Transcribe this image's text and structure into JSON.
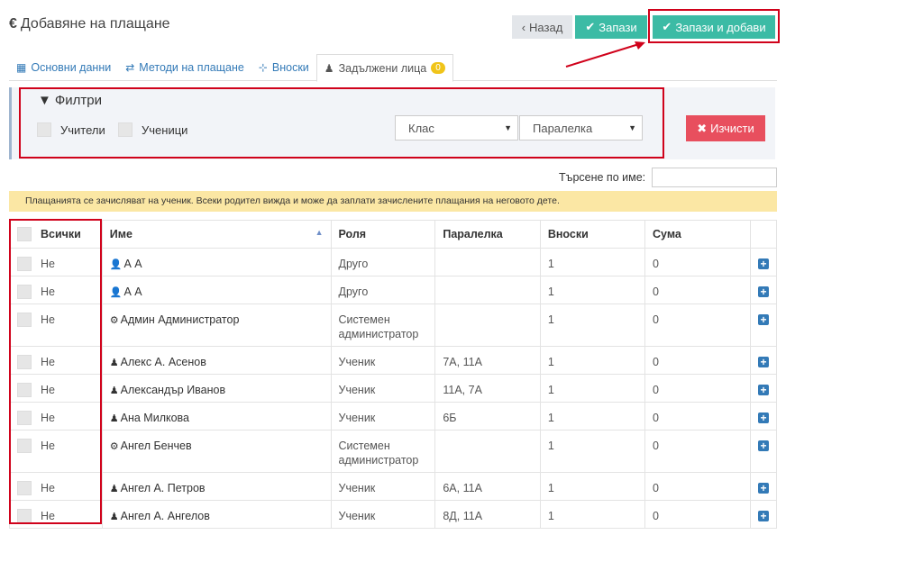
{
  "header": {
    "title_icon": "€",
    "title": "Добавяне на плащане",
    "back_label": "Назад",
    "save_label": "Запази",
    "save_add_label": "Запази и добави"
  },
  "tabs": [
    {
      "label": "Основни данни",
      "icon": "grid-icon"
    },
    {
      "label": "Методи на плащане",
      "icon": "exchange-icon"
    },
    {
      "label": "Вноски",
      "icon": "sitemap-icon"
    },
    {
      "label": "Задължени лица",
      "icon": "student-icon",
      "badge": "0"
    }
  ],
  "filters": {
    "title": "Филтри",
    "teachers_label": "Учители",
    "students_label": "Ученици",
    "class_select": "Клас",
    "paralelka_select": "Паралелка",
    "clear_label": "Изчисти"
  },
  "search": {
    "label": "Търсене по име:",
    "value": ""
  },
  "notice": "Плащанията се зачисляват на ученик. Всеки родител вижда и може да заплати зачислените плащания на неговото дете.",
  "table": {
    "headers": {
      "all": "Всички",
      "name": "Име",
      "role": "Роля",
      "paralelka": "Паралелка",
      "vnoski": "Вноски",
      "suma": "Сума"
    },
    "rows": [
      {
        "chk": "Не",
        "icon": "user-icon",
        "glyph": "👤",
        "name": "А А",
        "role": "Друго",
        "paralelka": "",
        "vnoski": "1",
        "suma": "0"
      },
      {
        "chk": "Не",
        "icon": "user-icon",
        "glyph": "👤",
        "name": "А А",
        "role": "Друго",
        "paralelka": "",
        "vnoski": "1",
        "suma": "0"
      },
      {
        "chk": "Не",
        "icon": "gear-icon",
        "glyph": "⚙",
        "name": "Админ Администратор",
        "role": "Системен администратор",
        "paralelka": "",
        "vnoski": "1",
        "suma": "0"
      },
      {
        "chk": "Не",
        "icon": "student-icon",
        "glyph": "♟",
        "name": "Алекс А. Асенов",
        "role": "Ученик",
        "paralelka": "7А, 11А",
        "vnoski": "1",
        "suma": "0"
      },
      {
        "chk": "Не",
        "icon": "student-icon",
        "glyph": "♟",
        "name": "Александър Иванов",
        "role": "Ученик",
        "paralelka": "11А, 7А",
        "vnoski": "1",
        "suma": "0"
      },
      {
        "chk": "Не",
        "icon": "student-icon",
        "glyph": "♟",
        "name": "Ана Милкова",
        "role": "Ученик",
        "paralelka": "6Б",
        "vnoski": "1",
        "suma": "0"
      },
      {
        "chk": "Не",
        "icon": "gear-icon",
        "glyph": "⚙",
        "name": "Ангел Бенчев",
        "role": "Системен администратор",
        "paralelka": "",
        "vnoski": "1",
        "suma": "0"
      },
      {
        "chk": "Не",
        "icon": "student-icon",
        "glyph": "♟",
        "name": "Ангел А. Петров",
        "role": "Ученик",
        "paralelka": "6А, 11А",
        "vnoski": "1",
        "suma": "0"
      },
      {
        "chk": "Не",
        "icon": "student-icon",
        "glyph": "♟",
        "name": "Ангел А. Ангелов",
        "role": "Ученик",
        "paralelka": "8Д, 11А",
        "vnoski": "1",
        "suma": "0"
      }
    ]
  }
}
